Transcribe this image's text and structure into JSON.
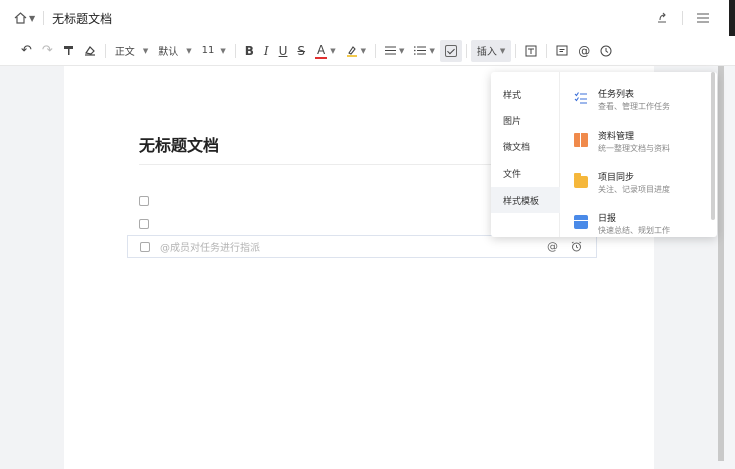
{
  "titlebar": {
    "home_icon": "home-icon",
    "doc_title": "无标题文档",
    "share_icon": "share-icon",
    "menu_icon": "hamburger-menu-icon"
  },
  "toolbar": {
    "undo": "↶",
    "redo": "↷",
    "format_painter": "format-painter-icon",
    "clear_format": "eraser-icon",
    "paragraph_style": "正文",
    "font_family": "默认",
    "font_size": "11",
    "bold": "B",
    "italic": "I",
    "underline": "U",
    "strikethrough": "S",
    "font_color": "A",
    "highlight": "highlight-icon",
    "align": "align-icon",
    "list": "list-icon",
    "todo": "checkbox-icon",
    "insert": "插入",
    "more": [
      "comment-icon",
      "at-icon",
      "history-icon"
    ]
  },
  "document": {
    "heading": "无标题文档",
    "task_placeholder": "@成员对任务进行指派",
    "at_symbol": "@",
    "alarm_icon": "alarm-icon"
  },
  "insert_menu": {
    "categories": [
      {
        "label": "样式"
      },
      {
        "label": "图片"
      },
      {
        "label": "微文档"
      },
      {
        "label": "文件"
      },
      {
        "label": "样式模板"
      }
    ],
    "active_category": "样式模板",
    "items": [
      {
        "name": "任务列表",
        "desc": "查看、管理工作任务",
        "icon": "task-list-icon",
        "color": "#3b6fd8"
      },
      {
        "name": "资料管理",
        "desc": "统一整理文档与资料",
        "icon": "book-icon",
        "color": "#f08a4b"
      },
      {
        "name": "项目同步",
        "desc": "关注、记录项目进度",
        "icon": "folder-icon",
        "color": "#f5b73b"
      },
      {
        "name": "日报",
        "desc": "快速总结、规划工作",
        "icon": "calendar-icon",
        "color": "#4a8ae8"
      }
    ]
  }
}
